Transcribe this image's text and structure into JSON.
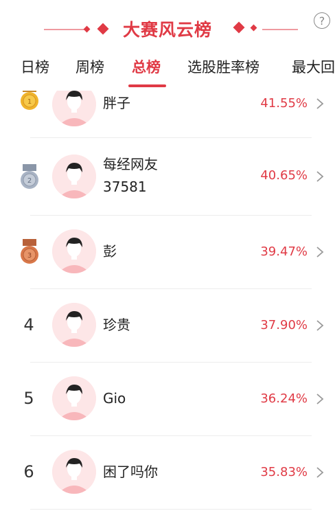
{
  "header": {
    "title": "大赛风云榜",
    "help_label": "?",
    "colors": {
      "accent": "#e03a45",
      "light_accent": "#ef9aa0"
    }
  },
  "tabs": [
    {
      "label": "日榜",
      "active": false
    },
    {
      "label": "周榜",
      "active": false
    },
    {
      "label": "总榜",
      "active": true
    },
    {
      "label": "选股胜率榜",
      "active": false
    },
    {
      "label": "最大回",
      "active": false
    }
  ],
  "rankings": [
    {
      "rank": "1",
      "medal": "gold",
      "name": "胖子",
      "rate": "41.55%"
    },
    {
      "rank": "2",
      "medal": "silver",
      "name": "每经网友",
      "name2": "37581",
      "rate": "40.65%"
    },
    {
      "rank": "3",
      "medal": "bronze",
      "name": "彭",
      "rate": "39.47%"
    },
    {
      "rank": "4",
      "name": "珍贵",
      "rate": "37.90%"
    },
    {
      "rank": "5",
      "name": "Gio",
      "rate": "36.24%"
    },
    {
      "rank": "6",
      "name": "困了吗你",
      "rate": "35.83%"
    }
  ]
}
